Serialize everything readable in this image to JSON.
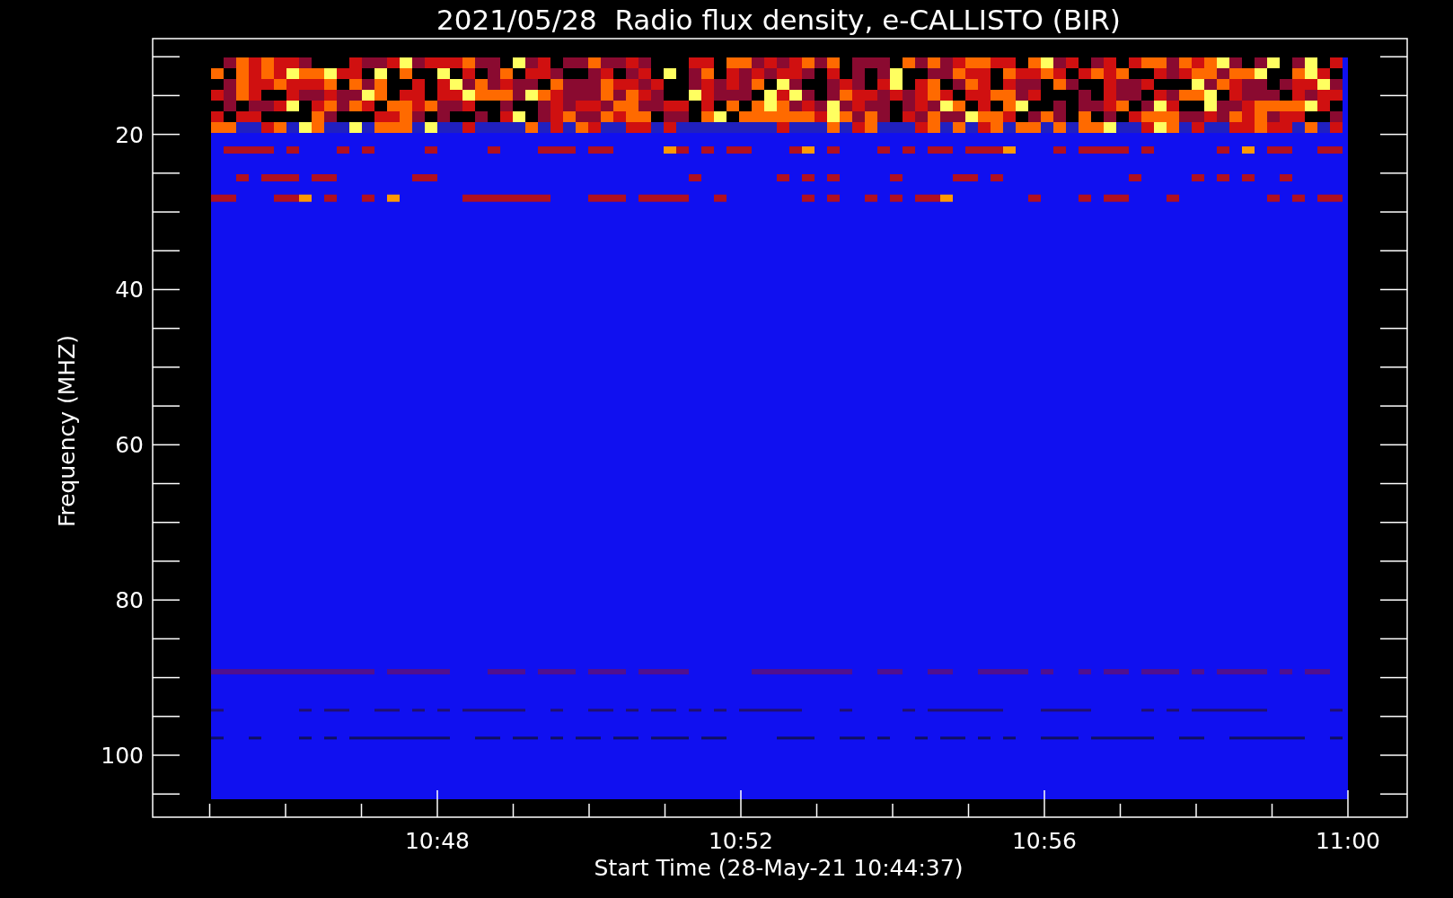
{
  "title": "2021/05/28  Radio flux density, e-CALLISTO (BIR)",
  "y_axis": {
    "title": "Frequency (MHZ)",
    "ticks": [
      "20",
      "40",
      "60",
      "80",
      "100"
    ]
  },
  "x_axis": {
    "title": "Start Time (28-May-21 10:44:37)",
    "ticks": [
      "10:48",
      "10:52",
      "10:56",
      "11:00"
    ]
  }
}
